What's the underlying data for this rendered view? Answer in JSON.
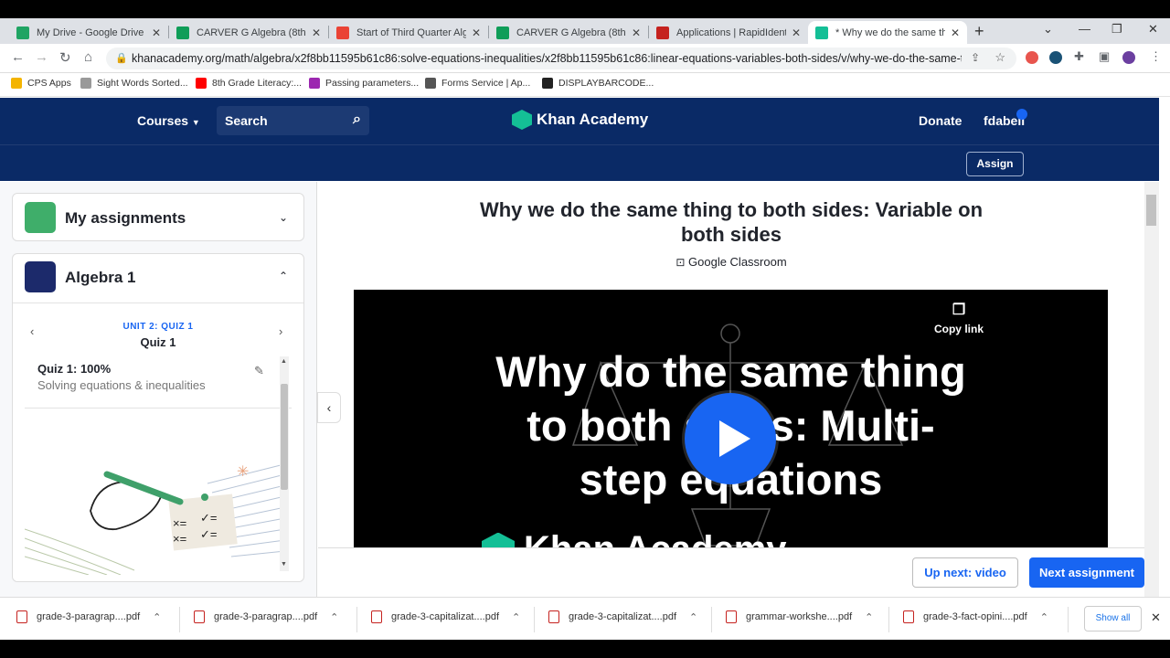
{
  "browser": {
    "tabs": [
      {
        "title": "My Drive - Google Drive",
        "color": "#1fa463"
      },
      {
        "title": "CARVER G Algebra (8th Gra",
        "color": "#0f9d58"
      },
      {
        "title": "Start of Third Quarter Algeb",
        "color": "#ea4335"
      },
      {
        "title": "CARVER G Algebra (8th Gra",
        "color": "#0f9d58"
      },
      {
        "title": "Applications | RapidIdentity",
        "color": "#c5221f"
      },
      {
        "title": "* Why we do the same thing",
        "color": "#14bf96"
      }
    ],
    "url": "khanacademy.org/math/algebra/x2f8bb11595b61c86:solve-equations-inequalities/x2f8bb11595b61c86:linear-equations-variables-both-sides/v/why-we-do-the-same-thing-to...",
    "bookmarks": [
      "CPS Apps",
      "Sight Words Sorted...",
      "8th Grade Literacy:...",
      "Passing parameters...",
      "Forms Service | Ap...",
      "DISPLAYBARCODE..."
    ]
  },
  "header": {
    "courses": "Courses",
    "search": "Search",
    "logo": "Khan Academy",
    "donate": "Donate",
    "user": "fdabell",
    "assign": "Assign"
  },
  "sidebar": {
    "assignments": "My assignments",
    "course": "Algebra 1",
    "unit_label": "UNIT 2: QUIZ 1",
    "unit_title": "Quiz 1",
    "quiz_title": "Quiz 1: 100%",
    "quiz_sub": "Solving equations & inequalities"
  },
  "main": {
    "title": "Why we do the same thing to both sides: Variable on both sides",
    "classroom": "Google Classroom",
    "video_text": "Why do the same thing to both sides: Multi-step equations",
    "copy_link": "Copy link",
    "video_logo": "Khan Academy"
  },
  "actions": {
    "up_next": "Up next: video",
    "next_assignment": "Next assignment"
  },
  "downloads": {
    "files": [
      "grade-3-paragrap....pdf",
      "grade-3-paragrap....pdf",
      "grade-3-capitalizat....pdf",
      "grade-3-capitalizat....pdf",
      "grammar-workshe....pdf",
      "grade-3-fact-opini....pdf"
    ],
    "show_all": "Show all"
  }
}
